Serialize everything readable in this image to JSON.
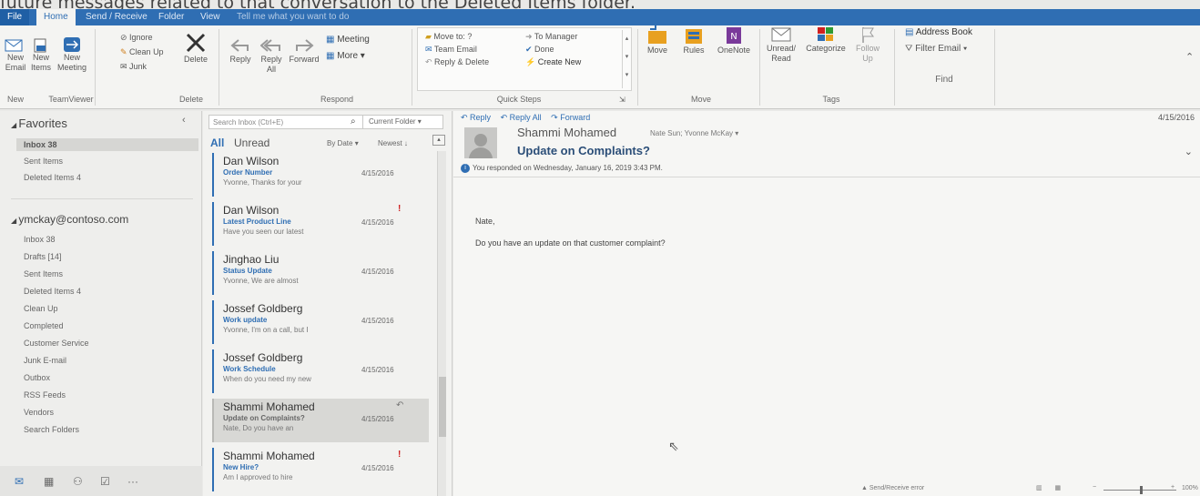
{
  "caption": "future messages related to that conversation to the Deleted Items folder.",
  "tabs": [
    {
      "label": "File"
    },
    {
      "label": "Home"
    },
    {
      "label": "Send / Receive"
    },
    {
      "label": "Folder"
    },
    {
      "label": "View"
    },
    {
      "label": "Tell me what you want to do"
    }
  ],
  "ribbon": {
    "new_email": "New Email",
    "new_items": "New Items",
    "new_meeting": "New Meeting",
    "ignore": "Ignore",
    "clean_up": "Clean Up",
    "junk": "Junk",
    "delete": "Delete",
    "reply": "Reply",
    "reply_all": "Reply All",
    "forward": "Forward",
    "meeting": "Meeting",
    "more": "More",
    "qs_move": "Move to: ?",
    "qs_team": "Team Email",
    "qs_reply_delete": "Reply & Delete",
    "qs_manager": "To Manager",
    "qs_done": "Done",
    "qs_create": "Create New",
    "move": "Move",
    "rules": "Rules",
    "onenote": "OneNote",
    "unread_read": "Unread/ Read",
    "categorize": "Categorize",
    "follow_up": "Follow Up",
    "address_book": "Address Book",
    "filter_email": "Filter Email",
    "g_new": "New",
    "g_teamviewer": "TeamViewer",
    "g_delete": "Delete",
    "g_respond": "Respond",
    "g_quicksteps": "Quick Steps",
    "g_move": "Move",
    "g_tags": "Tags",
    "g_find": "Find"
  },
  "folders": {
    "favorites": "Favorites",
    "fav_items": [
      "Inbox 38",
      "Sent Items",
      "Deleted Items 4"
    ],
    "account": "ymckay@contoso.com",
    "acct_items": [
      "Inbox 38",
      "Drafts [14]",
      "Sent Items",
      "Deleted Items 4",
      "Clean Up",
      "Completed",
      "Customer Service",
      "Junk E-mail",
      "Outbox",
      "RSS Feeds",
      "Vendors",
      "Search Folders"
    ]
  },
  "msglist": {
    "search_placeholder": "Search Inbox (Ctrl+E)",
    "scope": "Current Folder",
    "filter_all": "All",
    "filter_unread": "Unread",
    "sort_by": "By Date",
    "sort_order": "Newest",
    "messages": [
      {
        "from": "Dan Wilson",
        "subject": "Order Number",
        "preview": "Yvonne, Thanks for your",
        "date": "4/15/2016"
      },
      {
        "from": "Dan Wilson",
        "subject": "Latest Product Line",
        "preview": "Have you seen our latest",
        "date": "4/15/2016",
        "flag": "!"
      },
      {
        "from": "Jinghao Liu",
        "subject": "Status Update",
        "preview": "Yvonne, We are almost",
        "date": "4/15/2016"
      },
      {
        "from": "Jossef Goldberg",
        "subject": "Work update",
        "preview": "Yvonne, I'm on a call, but I",
        "date": "4/15/2016"
      },
      {
        "from": "Jossef Goldberg",
        "subject": "Work Schedule",
        "preview": "When do you need my new",
        "date": "4/15/2016"
      },
      {
        "from": "Shammi Mohamed",
        "subject": "Update on Complaints?",
        "preview": "Nate, Do you have an",
        "date": "4/15/2016"
      },
      {
        "from": "Shammi Mohamed",
        "subject": "New Hire?",
        "preview": "Am I approved to hire",
        "date": "4/15/2016",
        "flag": "!"
      }
    ]
  },
  "reading": {
    "reply": "Reply",
    "reply_all": "Reply All",
    "forward": "Forward",
    "date": "4/15/2016",
    "sender": "Shammi Mohamed",
    "to": "Nate Sun; Yvonne McKay",
    "subject": "Update on Complaints?",
    "info": "You responded on Wednesday, January 16, 2019 3:43 PM.",
    "body_greeting": "Nate,",
    "body_text": "Do you have an update on that customer complaint?",
    "status": "Send/Receive error",
    "zoom": "100%"
  }
}
